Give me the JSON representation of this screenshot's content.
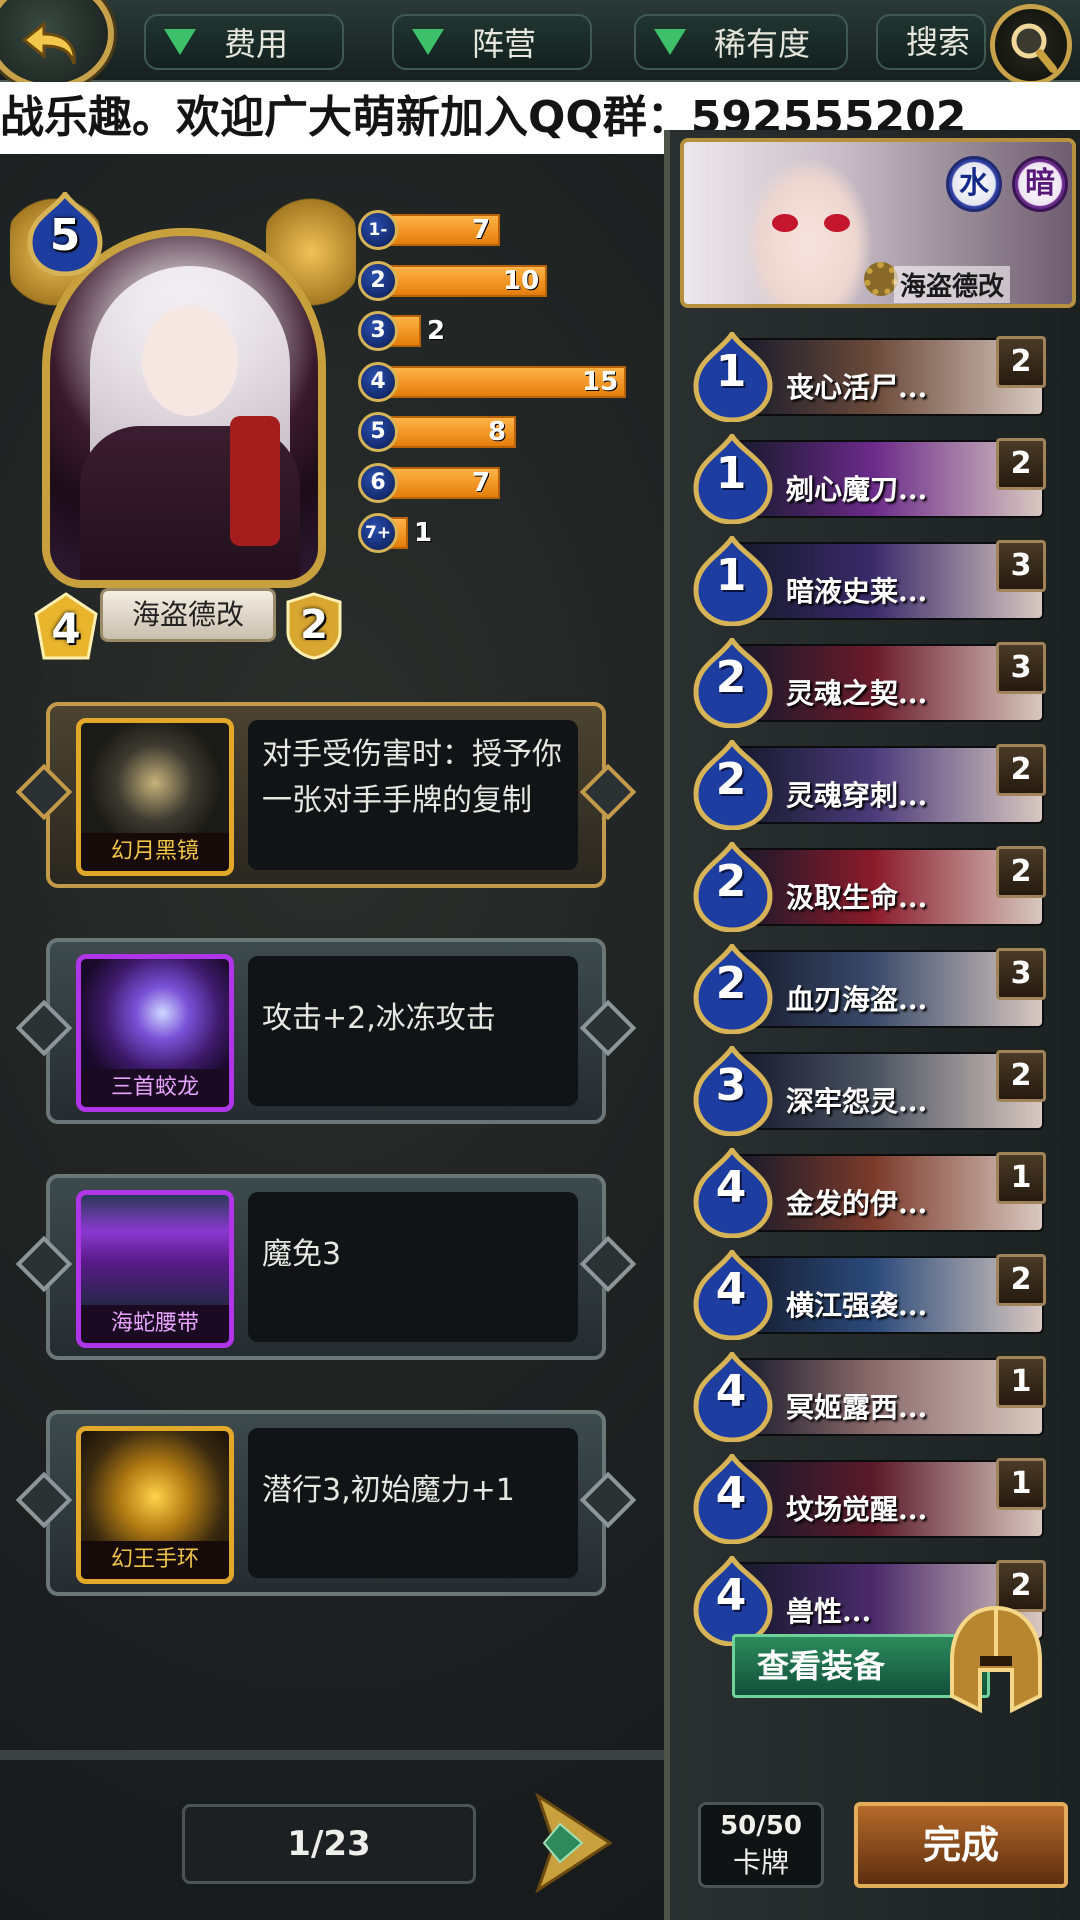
{
  "filters": {
    "cost_label": "费用",
    "faction_label": "阵营",
    "rarity_label": "稀有度",
    "search_label": "搜索"
  },
  "marquee": "战乐趣。欢迎广大萌新加入QQ群：592555202",
  "hero": {
    "name": "海盗德改",
    "cost": "5",
    "attack": "4",
    "health": "2"
  },
  "mana_curve": [
    {
      "label": "1-",
      "count": 7
    },
    {
      "label": "2",
      "count": 10
    },
    {
      "label": "3",
      "count": 2
    },
    {
      "label": "4",
      "count": 15
    },
    {
      "label": "5",
      "count": 8
    },
    {
      "label": "6",
      "count": 7
    },
    {
      "label": "7+",
      "count": 1
    }
  ],
  "equipment": [
    {
      "name": "幻月黑镜",
      "desc": "对手受伤害时：授予你一张对手手牌的复制",
      "rarity": "gold"
    },
    {
      "name": "三首蛟龙",
      "desc": "攻击+2,冰冻攻击",
      "rarity": "purple"
    },
    {
      "name": "海蛇腰带",
      "desc": "魔免3",
      "rarity": "purple"
    },
    {
      "name": "幻王手环",
      "desc": "潜行3,初始魔力+1",
      "rarity": "gold"
    }
  ],
  "pager": {
    "text": "1/23"
  },
  "deck_header": {
    "name": "海盗德改",
    "elements": [
      "水",
      "暗"
    ]
  },
  "deck": [
    {
      "cost": "1",
      "name": "丧心活尸...",
      "count": "2",
      "color": "#6a4a3a"
    },
    {
      "cost": "1",
      "name": "剜心魔刀...",
      "count": "2",
      "color": "#6b2a8a"
    },
    {
      "cost": "1",
      "name": "暗液史莱...",
      "count": "3",
      "color": "#3a2a6a"
    },
    {
      "cost": "2",
      "name": "灵魂之契...",
      "count": "3",
      "color": "#6a1a2a"
    },
    {
      "cost": "2",
      "name": "灵魂穿刺...",
      "count": "2",
      "color": "#4a3a7a"
    },
    {
      "cost": "2",
      "name": "汲取生命...",
      "count": "2",
      "color": "#8a1a2a"
    },
    {
      "cost": "2",
      "name": "血刃海盗...",
      "count": "3",
      "color": "#3a4a6a"
    },
    {
      "cost": "3",
      "name": "深牢怨灵...",
      "count": "2",
      "color": "#4a5260"
    },
    {
      "cost": "4",
      "name": "金发的伊...",
      "count": "1",
      "color": "#7a3a2a"
    },
    {
      "cost": "4",
      "name": "横江强袭...",
      "count": "2",
      "color": "#2a4a7a"
    },
    {
      "cost": "4",
      "name": "冥姬露西...",
      "count": "1",
      "color": "#8a6a6a"
    },
    {
      "cost": "4",
      "name": "坟场觉醒...",
      "count": "1",
      "color": "#5a1a2a"
    },
    {
      "cost": "4",
      "name": "兽性...",
      "count": "2",
      "color": "#4a2a6a"
    }
  ],
  "buttons": {
    "view_equipment": "查看装备",
    "done": "完成"
  },
  "card_count": {
    "value": "50/50",
    "label": "卡牌"
  },
  "colors": {
    "accent_gold": "#c9a03e",
    "bar_orange": "#f39a2a",
    "mana_blue": "#1d3ea0",
    "green": "#3ec06a"
  }
}
